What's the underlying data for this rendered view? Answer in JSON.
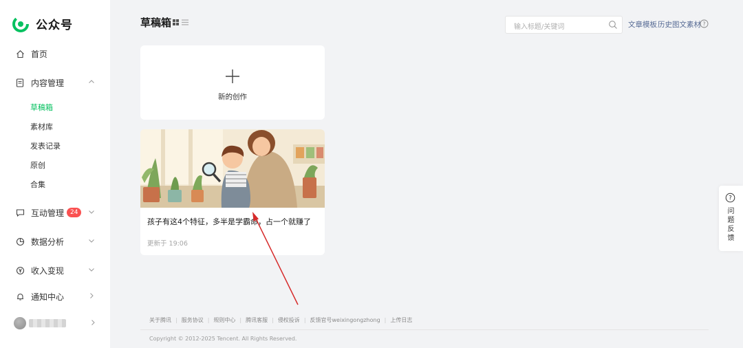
{
  "app": {
    "logo_text": "公众号",
    "brand_color": "#07c160"
  },
  "sidebar": {
    "home": "首页",
    "content_management": "内容管理",
    "content_sub": [
      "草稿箱",
      "素材库",
      "发表记录",
      "原创",
      "合集"
    ],
    "active_sub": "草稿箱",
    "interaction": "互动管理",
    "interaction_badge": "24",
    "data_analysis": "数据分析",
    "monetization": "收入变现",
    "notifications": "通知中心"
  },
  "header": {
    "title": "草稿箱",
    "search_placeholder": "输入标题/关键词",
    "link_templates": "文章模板",
    "link_history": "历史图文素材"
  },
  "drafts": {
    "new_label": "新的创作",
    "articles": [
      {
        "title": "孩子有这4个特征，多半是学霸命，占一个就赚了",
        "updated": "更新于 19:06"
      }
    ]
  },
  "footer": {
    "links": [
      "关于腾讯",
      "服务协议",
      "规则中心",
      "腾讯客服",
      "侵权投诉",
      "反馈官号weixingongzhong",
      "上传日志"
    ],
    "copyright": "Copyright © 2012-2025 Tencent. All Rights Reserved."
  },
  "feedback": {
    "label": "问题反馈"
  },
  "colors": {
    "accent_link": "#576b95",
    "badge": "#fa5151",
    "annotation_arrow": "#d62b2b"
  }
}
